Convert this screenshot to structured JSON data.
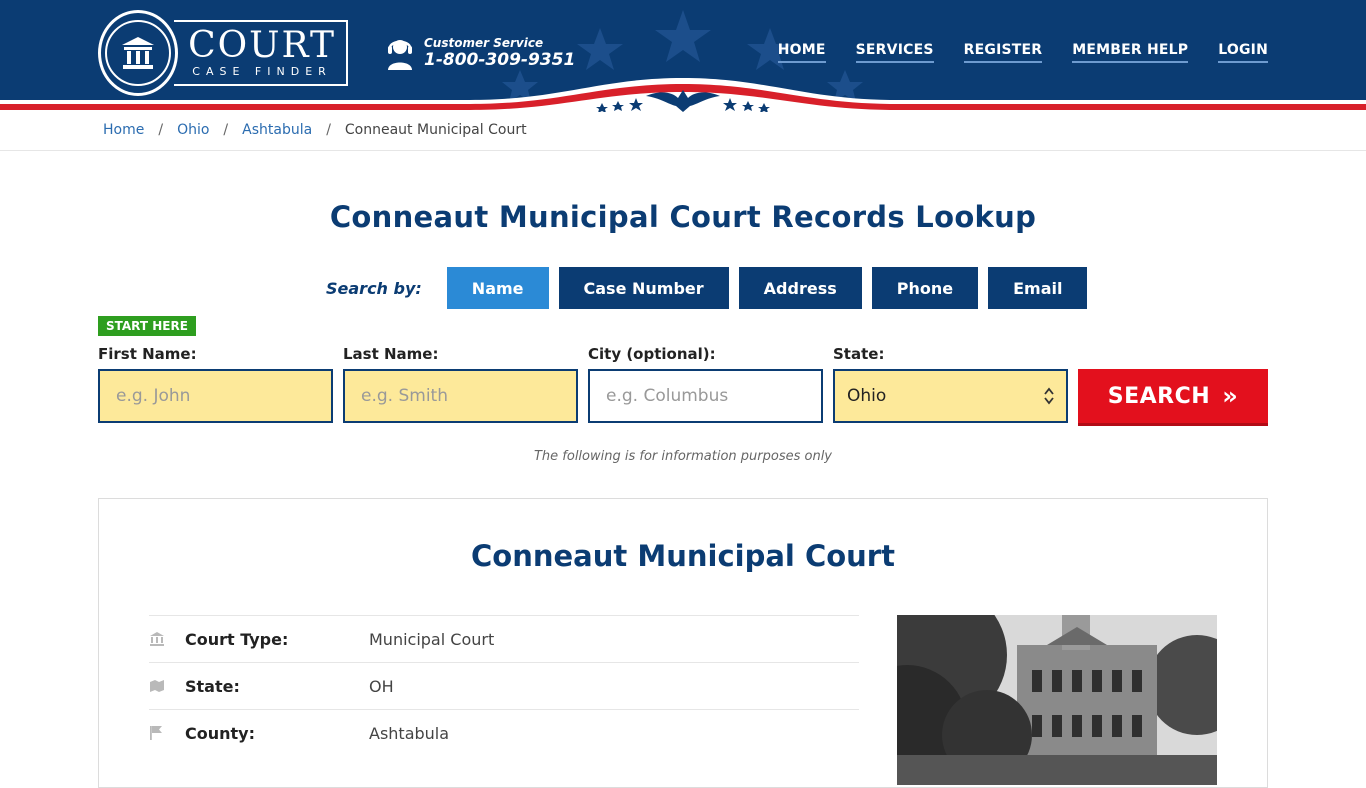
{
  "header": {
    "logo_word": "COURT",
    "logo_sub": "CASE FINDER",
    "cs_label": "Customer Service",
    "cs_phone": "1-800-309-9351",
    "nav": [
      {
        "label": "HOME"
      },
      {
        "label": "SERVICES"
      },
      {
        "label": "REGISTER"
      },
      {
        "label": "MEMBER HELP"
      },
      {
        "label": "LOGIN"
      }
    ],
    "colors": {
      "brand": "#0b3c73",
      "red": "#d8202a"
    }
  },
  "breadcrumb": {
    "items": [
      "Home",
      "Ohio",
      "Ashtabula"
    ],
    "current": "Conneaut Municipal Court"
  },
  "page_title": "Conneaut Municipal Court Records Lookup",
  "search": {
    "by_label": "Search by:",
    "tabs": [
      {
        "label": "Name",
        "active": true
      },
      {
        "label": "Case Number",
        "active": false
      },
      {
        "label": "Address",
        "active": false
      },
      {
        "label": "Phone",
        "active": false
      },
      {
        "label": "Email",
        "active": false
      }
    ],
    "start_here": "START HERE",
    "first_name": {
      "label": "First Name:",
      "placeholder": "e.g. John"
    },
    "last_name": {
      "label": "Last Name:",
      "placeholder": "e.g. Smith"
    },
    "city": {
      "label": "City (optional):",
      "placeholder": "e.g.  Columbus"
    },
    "state": {
      "label": "State:",
      "value": "Ohio"
    },
    "button": "SEARCH",
    "info": "The following is for information purposes only"
  },
  "court": {
    "title": "Conneaut Municipal Court",
    "rows": [
      {
        "icon": "courthouse-icon",
        "key": "Court Type:",
        "value": "Municipal Court"
      },
      {
        "icon": "map-icon",
        "key": "State:",
        "value": "OH"
      },
      {
        "icon": "flag-icon",
        "key": "County:",
        "value": "Ashtabula"
      }
    ]
  }
}
